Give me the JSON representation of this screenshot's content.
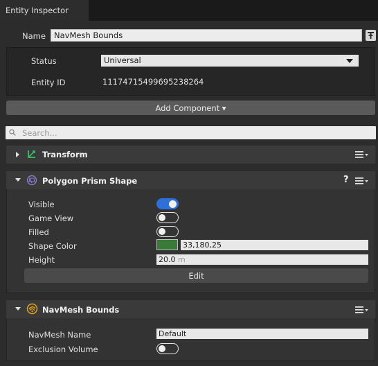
{
  "window": {
    "tab_title": "Entity Inspector"
  },
  "entity": {
    "name_label": "Name",
    "name_value": "NavMesh Bounds",
    "status_label": "Status",
    "status_value": "Universal",
    "id_label": "Entity ID",
    "id_value": "11174715499695238264"
  },
  "toolbar": {
    "add_component_label": "Add Component ▾"
  },
  "search": {
    "placeholder": "Search..."
  },
  "components": {
    "transform": {
      "title": "Transform",
      "icon": "transform-icon"
    },
    "polygon": {
      "title": "Polygon Prism Shape",
      "icon": "polygon-prism-icon",
      "help": "?",
      "visible_label": "Visible",
      "visible_on": true,
      "game_view_label": "Game View",
      "game_view_on": false,
      "filled_label": "Filled",
      "filled_on": false,
      "shape_color_label": "Shape Color",
      "shape_color_value": "33,180,25",
      "shape_color_hex": "#21b419",
      "height_label": "Height",
      "height_value": "20.0",
      "height_unit": "m",
      "edit_label": "Edit"
    },
    "navmesh": {
      "title": "NavMesh Bounds",
      "icon": "navmesh-icon",
      "navmesh_name_label": "NavMesh Name",
      "navmesh_name_value": "Default",
      "exclusion_label": "Exclusion Volume",
      "exclusion_on": false
    }
  },
  "colors": {
    "toggle_on": "#2f6fd8",
    "accent_transform": "#3fbf6a",
    "accent_navmesh": "#e2a11b"
  }
}
